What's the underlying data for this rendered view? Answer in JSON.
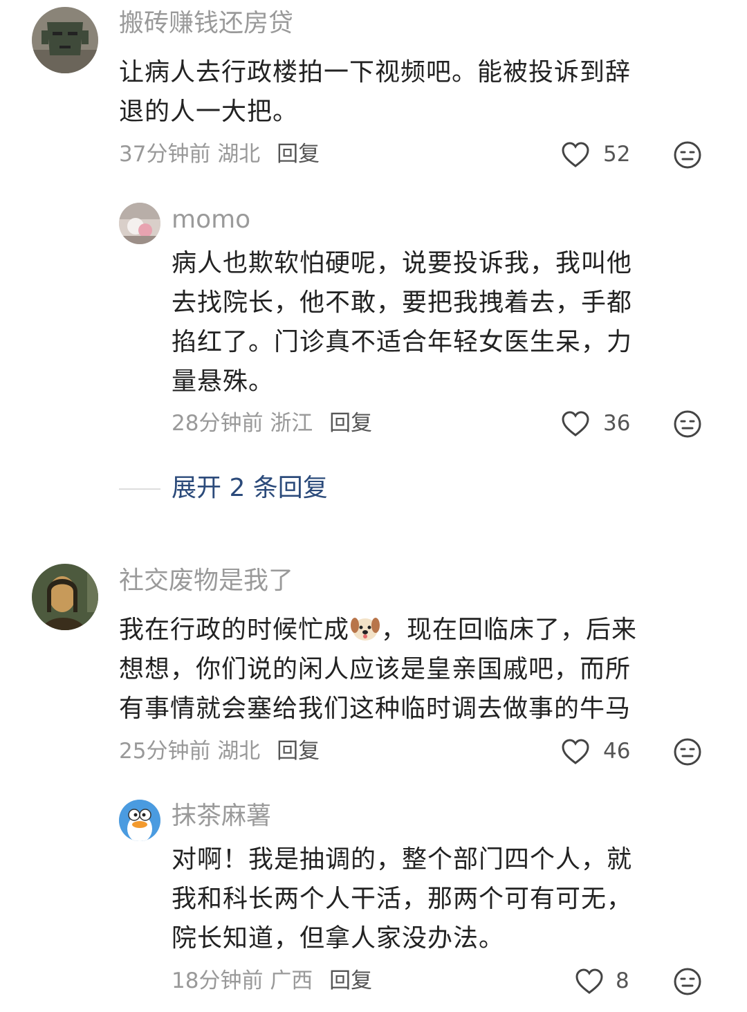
{
  "comments": [
    {
      "username": "搬砖赚钱还房贷",
      "text_lines": [
        "让病人去行政楼拍一下视频吧。能被投诉到辞",
        "退的人一大把。"
      ],
      "time": "37分钟前",
      "location": "湖北",
      "reply_label": "回复",
      "likes": "52"
    },
    {
      "username": "momo",
      "text_lines": [
        "病人也欺软怕硬呢，说要投诉我，我叫他",
        "去找院长，他不敢，要把我拽着去，手都",
        "掐红了。门诊真不适合年轻女医生呆，力",
        "量悬殊。"
      ],
      "time": "28分钟前",
      "location": "浙江",
      "reply_label": "回复",
      "likes": "36"
    },
    {
      "username": "社交废物是我了",
      "text_line1_before_emoji": "我在行政的时候忙成",
      "text_line1_after_emoji": "，现在回临床了，后来",
      "text_lines": [
        "想想，你们说的闲人应该是皇亲国戚吧，而所",
        "有事情就会塞给我们这种临时调去做事的牛马"
      ],
      "time": "25分钟前",
      "location": "湖北",
      "reply_label": "回复",
      "likes": "46"
    },
    {
      "username": "抹茶麻薯",
      "text_lines": [
        "对啊！我是抽调的，整个部门四个人，就",
        "我和科长两个人干活，那两个可有可无，",
        "院长知道，但拿人家没办法。"
      ],
      "time": "18分钟前",
      "location": "广西",
      "reply_label": "回复",
      "likes": "8"
    }
  ],
  "expand_replies": "展开 2 条回复",
  "colors": {
    "username": "#9a9a9a",
    "expand_link": "#2b4a7a",
    "text": "#222222",
    "meta": "#999999"
  },
  "icons": [
    "like-heart-icon",
    "dislike-face-icon",
    "dog-emoji-icon"
  ]
}
